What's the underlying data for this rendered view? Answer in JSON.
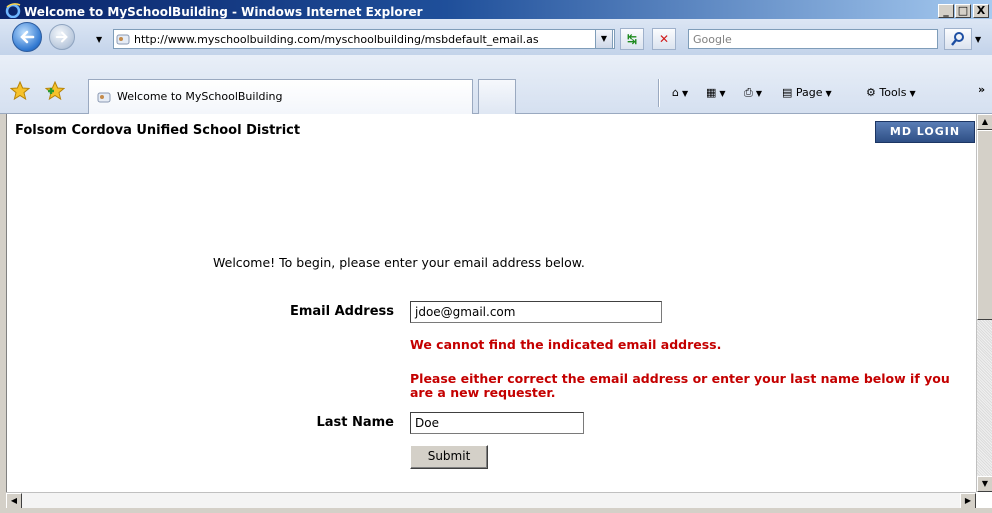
{
  "window": {
    "title": "Welcome to MySchoolBuilding - Windows Internet Explorer",
    "minimize_label": "_",
    "maximize_label": "□",
    "close_label": "X"
  },
  "navigation": {
    "address_url": "http://www.myschoolbuilding.com/myschoolbuilding/msbdefault_email.as",
    "search_placeholder": "Google",
    "refresh_icon": "refresh-icon",
    "stop_icon": "stop-icon"
  },
  "tabs": {
    "active_tab_label": "Welcome to MySchoolBuilding"
  },
  "commands": {
    "page_label": "Page",
    "tools_label": "Tools",
    "more_label": "»"
  },
  "page": {
    "district_name": "Folsom Cordova Unified School District",
    "md_login_label": "MD LOGIN",
    "welcome_text": "Welcome! To begin, please enter your email address below.",
    "email_label": "Email Address",
    "email_value": "jdoe@gmail.com",
    "error_not_found": "We cannot find the indicated email address.",
    "error_instruction": "Please either correct the email address or enter your last name below if you are a new requester.",
    "last_name_label": "Last Name",
    "last_name_value": "Doe",
    "submit_label": "Submit"
  },
  "colors": {
    "error": "#c40000",
    "title_bar": "#0a246a",
    "md_login_bg": "#2e4f85"
  }
}
